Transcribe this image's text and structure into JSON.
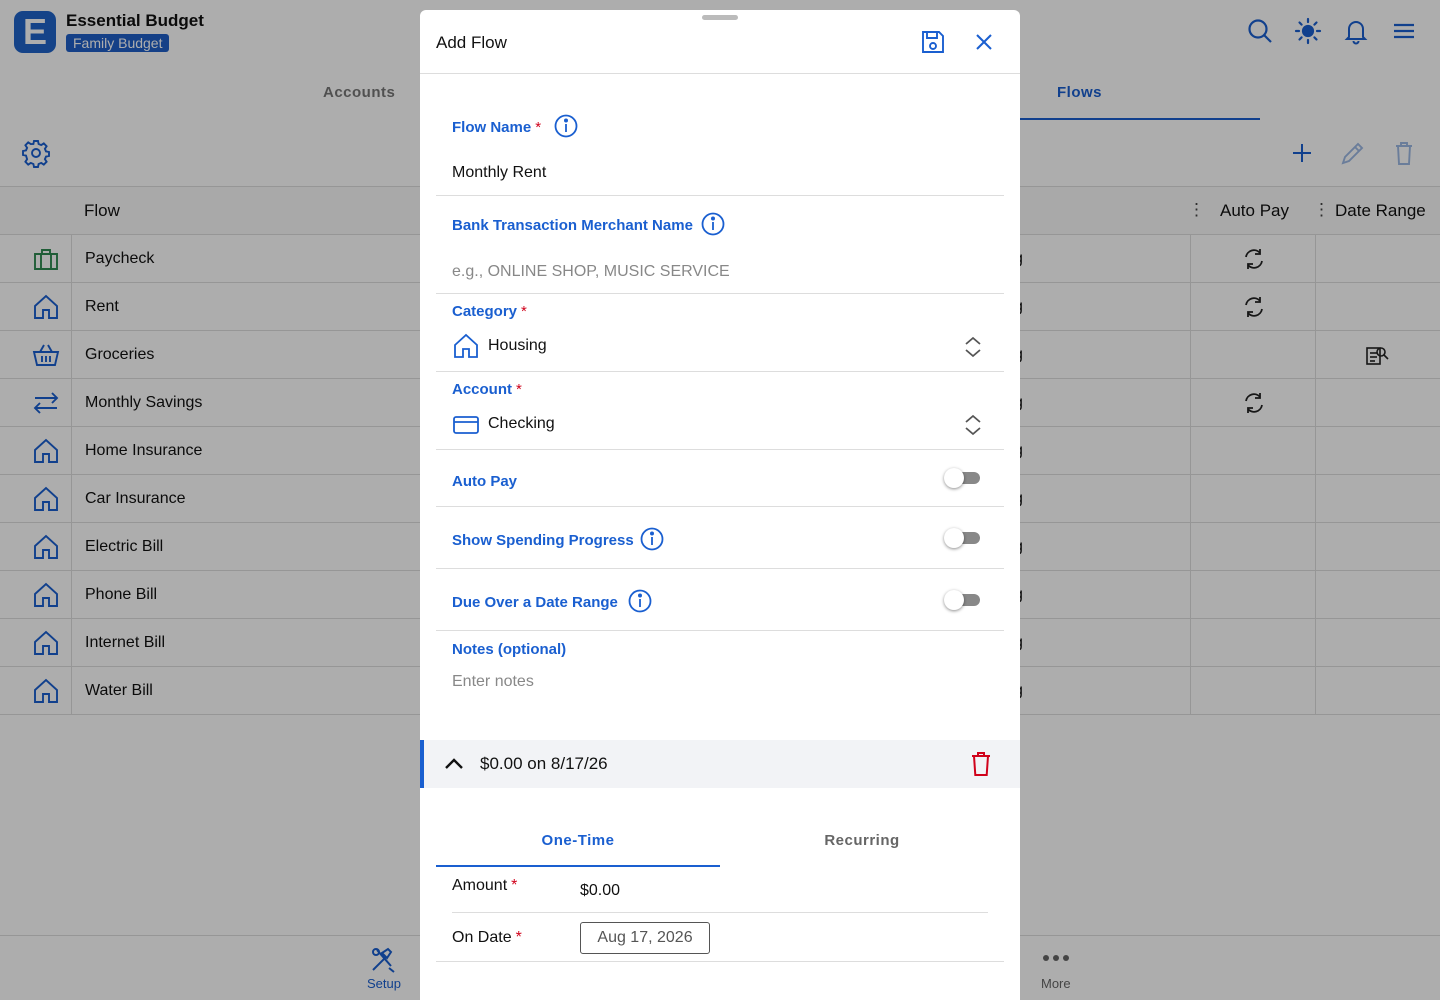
{
  "app": {
    "title": "Essential Budget",
    "logo_letter": "E",
    "budget_name": "Family Budget",
    "accent_color": "#1a5fd0"
  },
  "header_icons": [
    "search-icon",
    "brightness-icon",
    "bell-icon",
    "menu-icon"
  ],
  "tabs": [
    {
      "label": "Accounts",
      "active": false
    },
    {
      "label": "Flows",
      "active": true
    }
  ],
  "grid": {
    "columns": {
      "flow": "Flow",
      "auto_pay": "Auto Pay",
      "date_range": "Date Range"
    },
    "partial_cell_text": "g",
    "rows": [
      {
        "name": "Paycheck",
        "icon": "briefcase-icon",
        "auto_pay": true,
        "date_range": false
      },
      {
        "name": "Rent",
        "icon": "house-icon",
        "auto_pay": true,
        "date_range": false
      },
      {
        "name": "Groceries",
        "icon": "basket-icon",
        "auto_pay": false,
        "date_range": true
      },
      {
        "name": "Monthly Savings",
        "icon": "transfer-icon",
        "auto_pay": true,
        "date_range": false
      },
      {
        "name": "Home Insurance",
        "icon": "house-icon",
        "auto_pay": false,
        "date_range": false
      },
      {
        "name": "Car Insurance",
        "icon": "house-icon",
        "auto_pay": false,
        "date_range": false
      },
      {
        "name": "Electric Bill",
        "icon": "house-icon",
        "auto_pay": false,
        "date_range": false
      },
      {
        "name": "Phone Bill",
        "icon": "house-icon",
        "auto_pay": false,
        "date_range": false
      },
      {
        "name": "Internet Bill",
        "icon": "house-icon",
        "auto_pay": false,
        "date_range": false
      },
      {
        "name": "Water Bill",
        "icon": "house-icon",
        "auto_pay": false,
        "date_range": false
      }
    ]
  },
  "bottom_nav": {
    "setup": "Setup",
    "more": "More"
  },
  "modal": {
    "title": "Add Flow",
    "flow_name": {
      "label": "Flow Name",
      "required": "*",
      "value": "Monthly Rent"
    },
    "merchant": {
      "label": "Bank Transaction Merchant Name",
      "placeholder": "e.g., ONLINE SHOP, MUSIC SERVICE"
    },
    "category": {
      "label": "Category",
      "required": "*",
      "value": "Housing",
      "icon": "house-icon"
    },
    "account": {
      "label": "Account",
      "required": "*",
      "value": "Checking",
      "icon": "credit-card-icon"
    },
    "auto_pay": {
      "label": "Auto Pay",
      "on": false
    },
    "spending_progress": {
      "label": "Show Spending Progress",
      "on": false
    },
    "date_range": {
      "label": "Due Over a Date Range",
      "on": false
    },
    "notes": {
      "label": "Notes (optional)",
      "placeholder": "Enter notes"
    },
    "occurrence": {
      "summary": "$0.00 on 8/17/26",
      "tabs": [
        {
          "label": "One-Time",
          "active": true
        },
        {
          "label": "Recurring",
          "active": false
        }
      ],
      "amount": {
        "label": "Amount",
        "required": "*",
        "value": "$0.00"
      },
      "on_date": {
        "label": "On Date",
        "required": "*",
        "value": "Aug 17, 2026"
      }
    },
    "danger_color": "#d0021b"
  }
}
